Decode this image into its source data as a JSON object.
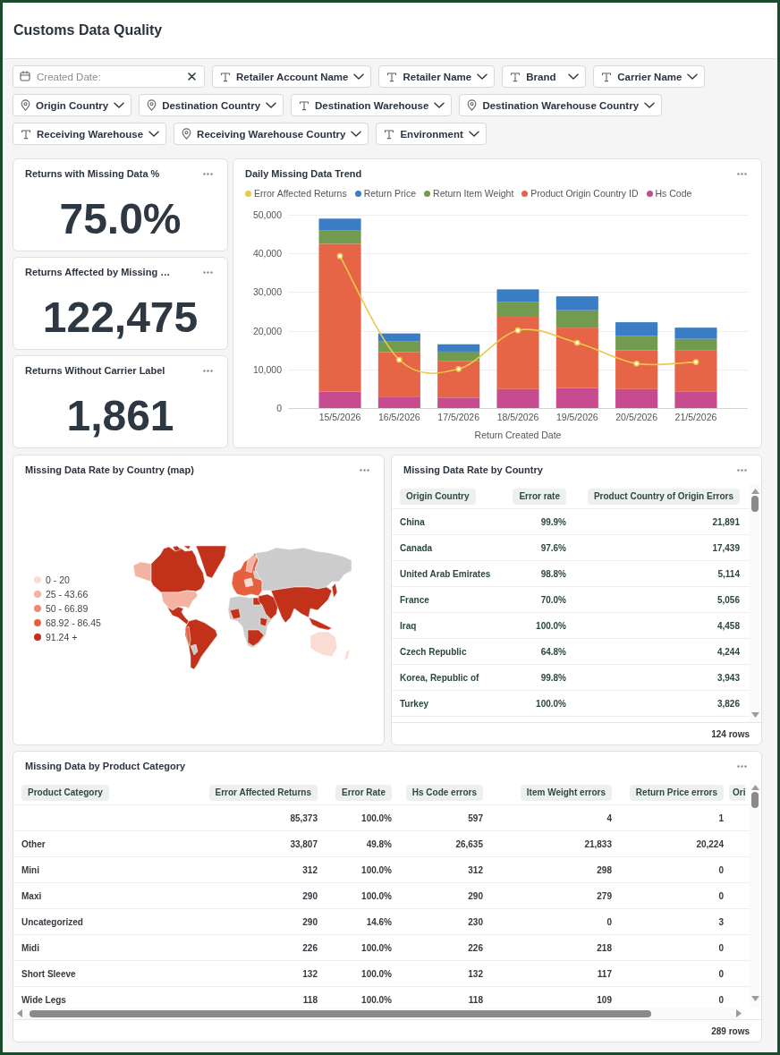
{
  "header": {
    "title": "Customs Data Quality"
  },
  "filters": [
    {
      "kind": "date",
      "placeholder": "Created Date:"
    },
    {
      "kind": "text",
      "label": "Retailer Account Name"
    },
    {
      "kind": "text",
      "label": "Retailer Name"
    },
    {
      "kind": "text",
      "label": "Brand"
    },
    {
      "kind": "text",
      "label": "Carrier Name"
    },
    {
      "kind": "location",
      "label": "Origin Country"
    },
    {
      "kind": "location",
      "label": "Destination Country"
    },
    {
      "kind": "text",
      "label": "Destination Warehouse"
    },
    {
      "kind": "location",
      "label": "Destination Warehouse Country"
    },
    {
      "kind": "text",
      "label": "Receiving Warehouse"
    },
    {
      "kind": "location",
      "label": "Receiving Warehouse Country"
    },
    {
      "kind": "text",
      "label": "Environment"
    }
  ],
  "kpis": [
    {
      "title": "Returns with Missing Data %",
      "value": "75.0%"
    },
    {
      "title": "Returns Affected by Missing …",
      "value": "122,475"
    },
    {
      "title": "Returns Without Carrier Label",
      "value": "1,861"
    }
  ],
  "trend_chart": {
    "title": "Daily Missing Data Trend",
    "chart_data": {
      "type": "bar",
      "stacked": true,
      "legend": "top",
      "grid": true,
      "xlabel": "Return Created Date",
      "categories": [
        "15/5/2026",
        "16/5/2026",
        "17/5/2026",
        "18/5/2026",
        "19/5/2026",
        "20/5/2026",
        "21/5/2026"
      ],
      "ylim": [
        0,
        50000
      ],
      "yticks": [
        {
          "value": 0,
          "label": "0"
        },
        {
          "value": 10000,
          "label": "10,000"
        },
        {
          "value": 20000,
          "label": "20,000"
        },
        {
          "value": 30000,
          "label": "30,000"
        },
        {
          "value": 40000,
          "label": "40,000"
        },
        {
          "value": 50000,
          "label": "50,000"
        }
      ],
      "series": [
        {
          "name": "Error Affected Returns",
          "type": "line",
          "marker": "circle",
          "color": "#ecc94b",
          "values": [
            39300,
            12500,
            10100,
            20100,
            16900,
            11500,
            11900
          ]
        },
        {
          "name": "Return Price",
          "color": "#3b7dc4",
          "values": [
            3100,
            2100,
            1900,
            3200,
            3600,
            3500,
            2900
          ]
        },
        {
          "name": "Return Item Weight",
          "color": "#739b4f",
          "values": [
            3400,
            2700,
            2500,
            3900,
            4500,
            3800,
            2900
          ]
        },
        {
          "name": "Product Origin Country ID",
          "color": "#e66546",
          "values": [
            38200,
            11700,
            9400,
            18700,
            15600,
            10000,
            10800
          ]
        },
        {
          "name": "Hs Code",
          "color": "#c64b8f",
          "values": [
            4300,
            2800,
            2700,
            4900,
            5200,
            4900,
            4200
          ]
        }
      ]
    }
  },
  "map_panel": {
    "title": "Missing Data Rate by Country (map)",
    "legend": [
      {
        "label": "0 - 20",
        "color": "#fbdcd5"
      },
      {
        "label": "25 - 43.66",
        "color": "#f4b2a2"
      },
      {
        "label": "50 - 66.89",
        "color": "#ee8b72"
      },
      {
        "label": "68.92 - 86.45",
        "color": "#e5603f"
      },
      {
        "label": "91.24 +",
        "color": "#c2321b"
      }
    ]
  },
  "country_table": {
    "title": "Missing Data Rate by Country",
    "columns": [
      "Origin Country",
      "Error rate",
      "Product Country of Origin Errors"
    ],
    "rows": [
      [
        "China",
        "99.9%",
        "21,891"
      ],
      [
        "Canada",
        "97.6%",
        "17,439"
      ],
      [
        "United Arab Emirates",
        "98.8%",
        "5,114"
      ],
      [
        "France",
        "70.0%",
        "5,056"
      ],
      [
        "Iraq",
        "100.0%",
        "4,458"
      ],
      [
        "Czech Republic",
        "64.8%",
        "4,244"
      ],
      [
        "Korea, Republic of",
        "99.8%",
        "3,943"
      ],
      [
        "Turkey",
        "100.0%",
        "3,826"
      ]
    ],
    "row_count": "124 rows"
  },
  "category_table": {
    "title": "Missing Data by Product Category",
    "columns": [
      "Product Category",
      "Error Affected Returns",
      "Error Rate",
      "Hs Code errors",
      "Item Weight errors",
      "Return Price errors",
      "Ori"
    ],
    "rows": [
      [
        null,
        "85,373",
        "100.0%",
        "597",
        "4",
        "1"
      ],
      [
        "Other",
        "33,807",
        "49.8%",
        "26,635",
        "21,833",
        "20,224"
      ],
      [
        "Mini",
        "312",
        "100.0%",
        "312",
        "298",
        "0"
      ],
      [
        "Maxi",
        "290",
        "100.0%",
        "290",
        "279",
        "0"
      ],
      [
        "Uncategorized",
        "290",
        "14.6%",
        "230",
        "0",
        "3"
      ],
      [
        "Midi",
        "226",
        "100.0%",
        "226",
        "218",
        "0"
      ],
      [
        "Short Sleeve",
        "132",
        "100.0%",
        "132",
        "117",
        "0"
      ],
      [
        "Wide Legs",
        "118",
        "100.0%",
        "118",
        "109",
        "0"
      ]
    ],
    "row_count": "289 rows"
  }
}
